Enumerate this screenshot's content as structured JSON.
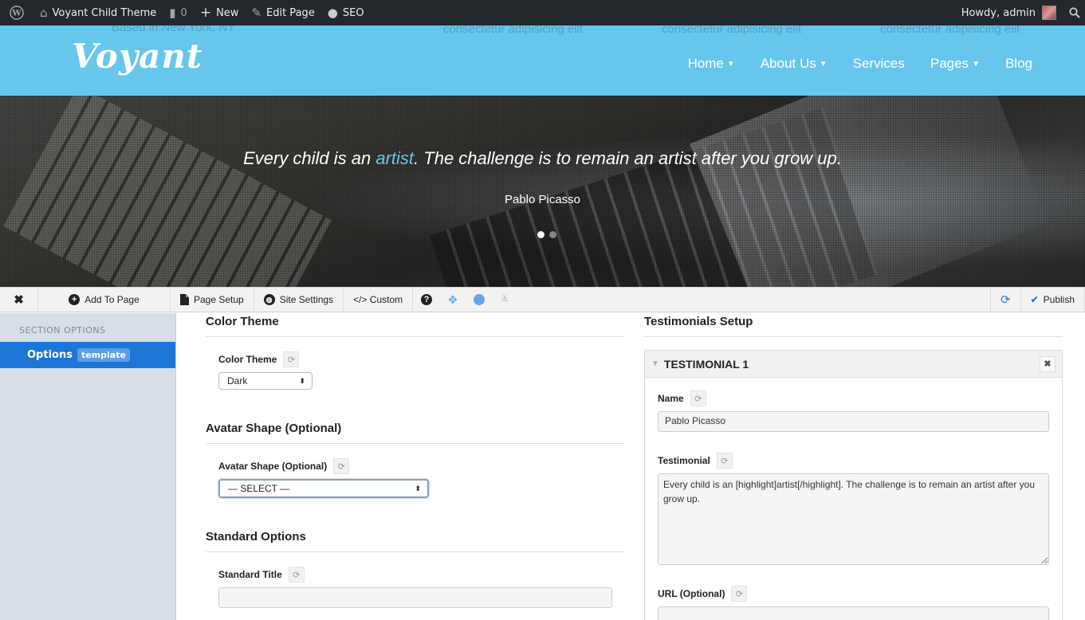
{
  "adminbar": {
    "site_name": "Voyant Child Theme",
    "comments_count": "0",
    "new_label": "New",
    "edit_label": "Edit Page",
    "seo_label": "SEO",
    "howdy": "Howdy, admin"
  },
  "header": {
    "logo": "Voyant",
    "ghost_text": [
      "Based in New York, NY",
      "consectetur adipisicing elit",
      "consectetur adipisicing elit",
      "consectetur adipisicing elit"
    ],
    "nav": [
      {
        "label": "Home",
        "dropdown": true
      },
      {
        "label": "About Us",
        "dropdown": true
      },
      {
        "label": "Services",
        "dropdown": false
      },
      {
        "label": "Pages",
        "dropdown": true
      },
      {
        "label": "Blog",
        "dropdown": false
      }
    ]
  },
  "hero": {
    "quote_before": "Every child is an ",
    "quote_highlight": "artist",
    "quote_after": ". The challenge is to remain an artist after you grow up.",
    "author": "Pablo Picasso",
    "slides": 2,
    "active_slide": 1,
    "highlight_color": "#66c6ec"
  },
  "toolbar": {
    "add_to_page": "Add To Page",
    "page_setup": "Page Setup",
    "site_settings": "Site Settings",
    "custom": "</> Custom",
    "publish": "Publish",
    "accent": "#2e7bd3"
  },
  "sidebar": {
    "heading": "SECTION OPTIONS",
    "items": [
      {
        "label": "Options",
        "badge": "template"
      }
    ]
  },
  "left_panel": {
    "color_theme": {
      "title": "Color Theme",
      "label": "Color Theme",
      "value": "Dark"
    },
    "avatar_shape": {
      "title": "Avatar Shape (Optional)",
      "label": "Avatar Shape (Optional)",
      "value": "— SELECT —"
    },
    "standard": {
      "title": "Standard Options",
      "label": "Standard Title",
      "value": ""
    }
  },
  "right_panel": {
    "title": "Testimonials Setup",
    "item_title": "TESTIMONIAL 1",
    "name_label": "Name",
    "name_value": "Pablo Picasso",
    "testimonial_label": "Testimonial",
    "testimonial_value": "Every child is an [highlight]artist[/highlight]. The challenge is to remain an artist after you grow up.",
    "url_label": "URL (Optional)",
    "url_value": ""
  }
}
